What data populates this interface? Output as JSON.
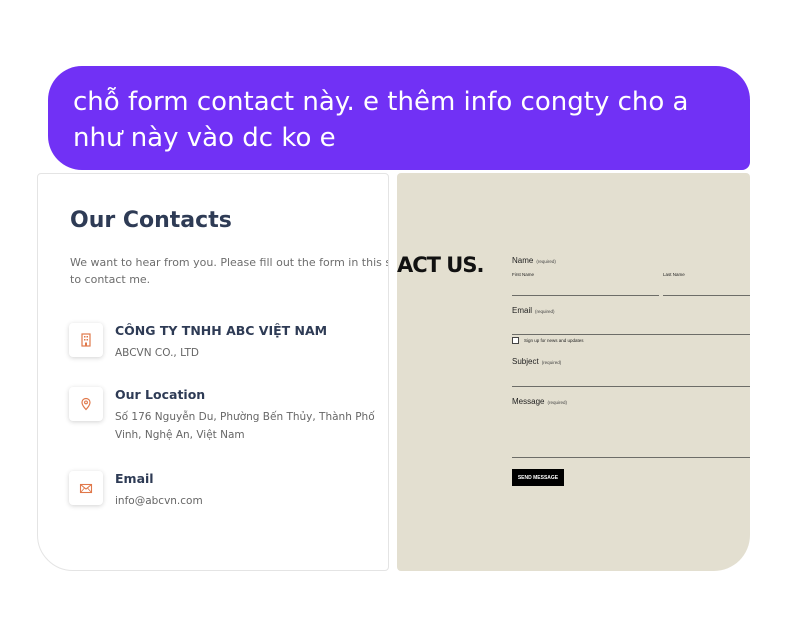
{
  "message": {
    "line1": "chỗ form contact này. e thêm info congty cho a",
    "line2": "như này vào dc ko e"
  },
  "contacts": {
    "title": "Our Contacts",
    "description_line1": "We want to hear from you. Please fill out the form in this sect",
    "description_line2": "to contact me.",
    "items": [
      {
        "icon": "building-icon",
        "title": "CÔNG TY TNHH ABC VIỆT NAM",
        "text": "ABCVN CO., LTD"
      },
      {
        "icon": "location-pin-icon",
        "title": "Our Location",
        "text": "Số 176 Nguyễn Du, Phường Bến Thủy, Thành Phố Vinh, Nghệ An, Việt Nam"
      },
      {
        "icon": "envelope-icon",
        "title": "Email",
        "text": "info@abcvn.com"
      }
    ],
    "accent_color": "#e0784a"
  },
  "form": {
    "heading": "ACT US.",
    "name_label": "Name",
    "required": "(required)",
    "first_name": "First Name",
    "last_name": "Last Name",
    "email_label": "Email",
    "signup_label": "Sign up for news and updates",
    "subject_label": "Subject",
    "message_label": "Message",
    "send_button": "SEND MESSAGE",
    "background": "#e3dfd0"
  },
  "colors": {
    "bubble": "#7131f5",
    "heading_text": "#2e3b55"
  }
}
